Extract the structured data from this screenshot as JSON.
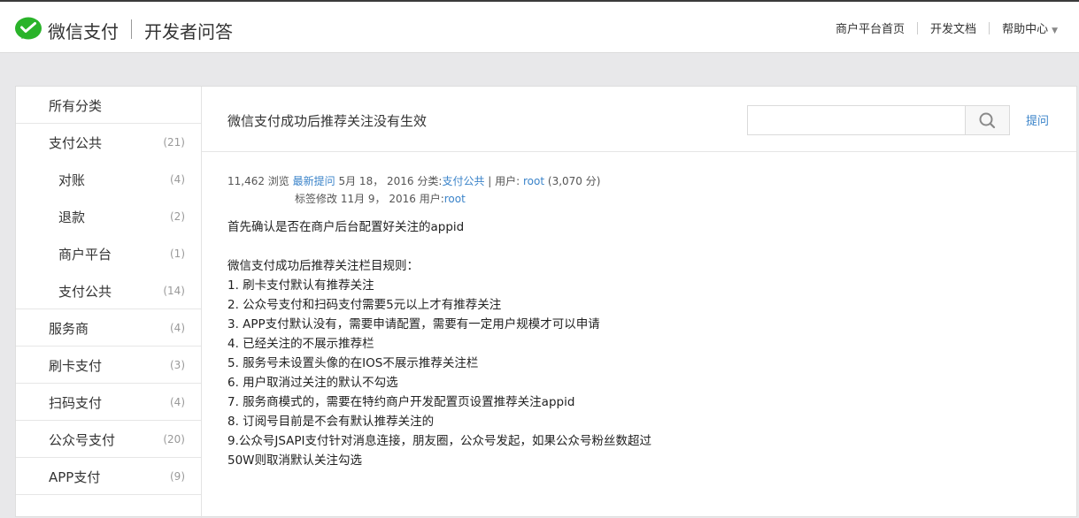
{
  "header": {
    "brand": "微信支付",
    "site_title": "开发者问答",
    "nav": [
      {
        "label": "商户平台首页"
      },
      {
        "label": "开发文档"
      },
      {
        "label": "帮助中心"
      }
    ]
  },
  "sidebar": {
    "items": [
      {
        "label": "所有分类",
        "count": ""
      },
      {
        "label": "支付公共",
        "count": "(21)"
      },
      {
        "label": "对账",
        "count": "(4)"
      },
      {
        "label": "退款",
        "count": "(2)"
      },
      {
        "label": "商户平台",
        "count": "(1)"
      },
      {
        "label": "支付公共",
        "count": "(14)"
      },
      {
        "label": "服务商",
        "count": "(4)"
      },
      {
        "label": "刷卡支付",
        "count": "(3)"
      },
      {
        "label": "扫码支付",
        "count": "(4)"
      },
      {
        "label": "公众号支付",
        "count": "(20)"
      },
      {
        "label": "APP支付",
        "count": "(9)"
      }
    ]
  },
  "question": {
    "title": "微信支付成功后推荐关注没有生效",
    "search_placeholder": "",
    "ask_label": "提问",
    "views": "11,462 浏览",
    "latest_label": "最新提问",
    "asked_date": "5月 18， 2016",
    "category_prefix": "分类:",
    "category": "支付公共",
    "user_prefix": "| 用户:",
    "asker": "root",
    "asker_points": "(3,070 分)",
    "edit_text": "标签修改 11月 9， 2016 用户:",
    "editor": "root",
    "body": "首先确认是否在商户后台配置好关注的appid\n\n微信支付成功后推荐关注栏目规则：\n1. 刷卡支付默认有推荐关注\n2. 公众号支付和扫码支付需要5元以上才有推荐关注\n3. APP支付默认没有，需要申请配置，需要有一定用户规模才可以申请\n4. 已经关注的不展示推荐栏\n5. 服务号未设置头像的在IOS不展示推荐关注栏\n6. 用户取消过关注的默认不勾选\n7. 服务商模式的，需要在特约商户开发配置页设置推荐关注appid\n8. 订阅号目前是不会有默认推荐关注的\n9.公众号JSAPI支付针对消息连接，朋友圈，公众号发起，如果公众号粉丝数超过\n50W则取消默认关注勾选"
  },
  "colors": {
    "accent_link": "#3a83c9",
    "brand_green": "#2ab32a",
    "page_bg": "#e8e8ea"
  },
  "icons": [
    "wechat-pay-logo-icon",
    "search-icon",
    "chevron-down-icon"
  ]
}
